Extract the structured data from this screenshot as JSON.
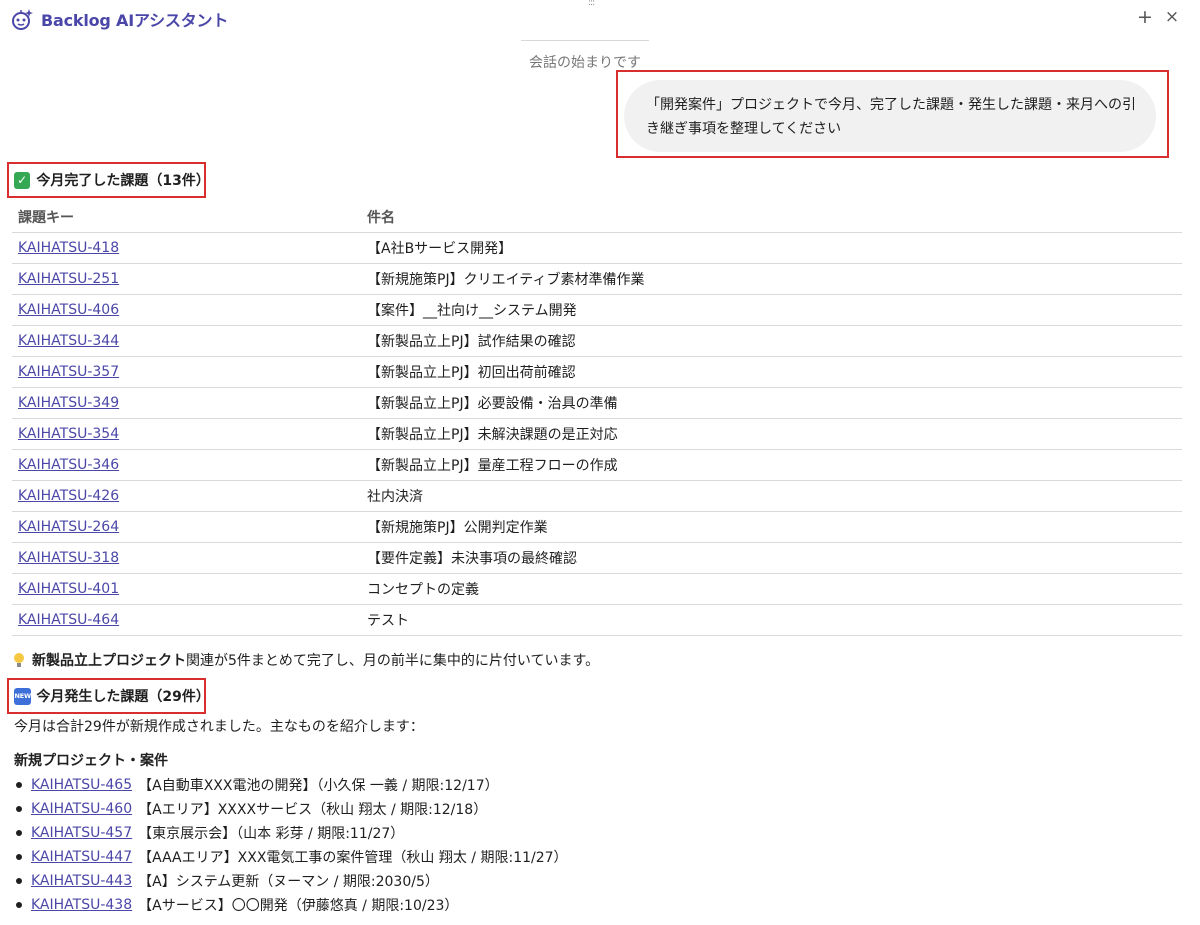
{
  "header": {
    "title": "Backlog AIアシスタント",
    "plus_glyph": "+",
    "close_glyph": "×",
    "drag_glyph": ":::"
  },
  "conversation": {
    "start_label": "会話の始まりです",
    "user_message": "「開発案件」プロジェクトで今月、完了した課題・発生した課題・来月への引き継ぎ事項を整理してください"
  },
  "completed": {
    "heading": "今月完了した課題（13件）",
    "columns": [
      "課題キー",
      "件名"
    ],
    "rows": [
      {
        "key": "KAIHATSU-418",
        "name": "【A社Bサービス開発】"
      },
      {
        "key": "KAIHATSU-251",
        "name": "【新規施策PJ】クリエイティブ素材準備作業"
      },
      {
        "key": "KAIHATSU-406",
        "name": "【案件】__社向け__システム開発"
      },
      {
        "key": "KAIHATSU-344",
        "name": "【新製品立上PJ】試作結果の確認"
      },
      {
        "key": "KAIHATSU-357",
        "name": "【新製品立上PJ】初回出荷前確認"
      },
      {
        "key": "KAIHATSU-349",
        "name": "【新製品立上PJ】必要設備・治具の準備"
      },
      {
        "key": "KAIHATSU-354",
        "name": "【新製品立上PJ】未解決課題の是正対応"
      },
      {
        "key": "KAIHATSU-346",
        "name": "【新製品立上PJ】量産工程フローの作成"
      },
      {
        "key": "KAIHATSU-426",
        "name": "社内決済"
      },
      {
        "key": "KAIHATSU-264",
        "name": "【新規施策PJ】公開判定作業"
      },
      {
        "key": "KAIHATSU-318",
        "name": "【要件定義】未決事項の最終確認"
      },
      {
        "key": "KAIHATSU-401",
        "name": "コンセプトの定義"
      },
      {
        "key": "KAIHATSU-464",
        "name": "テスト"
      }
    ],
    "note_bold": "新製品立上プロジェクト",
    "note_rest": "関連が5件まとめて完了し、月の前半に集中的に片付いています。"
  },
  "created": {
    "icon_label": "NEW",
    "heading": "今月発生した課題（29件）",
    "intro": "今月は合計29件が新規作成されました。主なものを紹介します：",
    "subheading": "新規プロジェクト・案件",
    "items": [
      {
        "key": "KAIHATSU-465",
        "text": "【A自動車XXX電池の開発】（小久保 一義 / 期限:12/17）"
      },
      {
        "key": "KAIHATSU-460",
        "text": "【Aエリア】XXXXサービス（秋山 翔太 / 期限:12/18）"
      },
      {
        "key": "KAIHATSU-457",
        "text": "【東京展示会】（山本 彩芽 / 期限:11/27）"
      },
      {
        "key": "KAIHATSU-447",
        "text": "【AAAエリア】XXX電気工事の案件管理（秋山 翔太 / 期限:11/27）"
      },
      {
        "key": "KAIHATSU-443",
        "text": "【A】システム更新（ヌーマン / 期限:2030/5）"
      },
      {
        "key": "KAIHATSU-438",
        "text": "【Aサービス】〇〇開発（伊藤悠真 / 期限:10/23）"
      }
    ]
  },
  "colors": {
    "accent": "#4b47a8",
    "highlight_border": "#d82e2e",
    "bubble_bg": "#f1f1f1"
  }
}
